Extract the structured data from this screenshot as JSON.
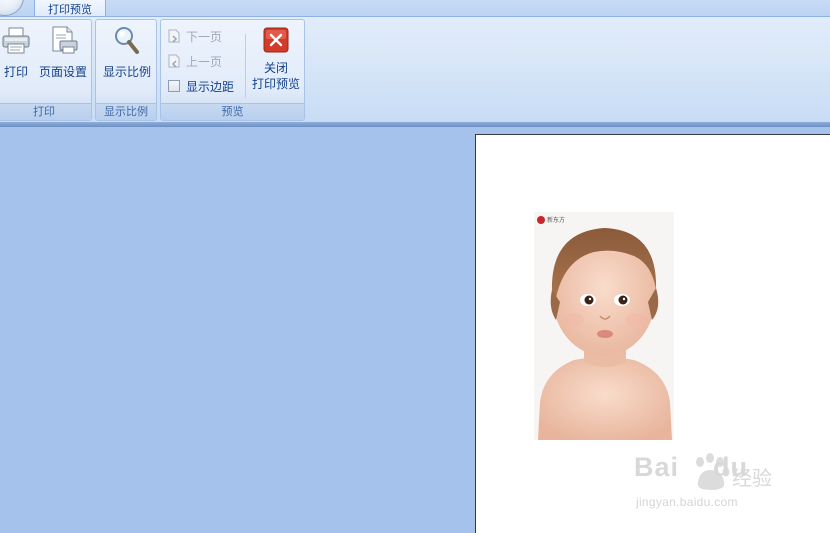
{
  "ribbon": {
    "active_tab": "打印预览",
    "groups": {
      "print": {
        "label": "打印",
        "print_button": "打印",
        "page_setup_button": "页面设置"
      },
      "zoom": {
        "label": "显示比例",
        "zoom_button": "显示比例"
      },
      "preview": {
        "label": "预览",
        "next_page": "下一页",
        "prev_page": "上一页",
        "show_margins": "显示边距",
        "close_preview_line1": "关闭",
        "close_preview_line2": "打印预览"
      }
    }
  },
  "document": {
    "photo_logo_text": "新东方"
  },
  "watermark": {
    "brand": "Bai",
    "brand2": "du",
    "product": "经验",
    "url": "jingyan.baidu.com"
  },
  "colors": {
    "workspace": "#a4c2eb",
    "ribbon_text": "#15428b",
    "close_icon": "#d23a2a"
  }
}
